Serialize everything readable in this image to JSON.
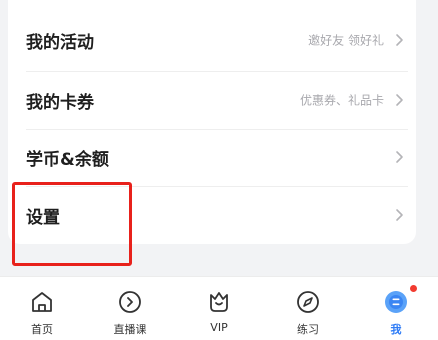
{
  "menu": {
    "items": [
      {
        "label": "我的活动",
        "sub": "邀好友 领好礼"
      },
      {
        "label": "我的卡券",
        "sub": "优惠券、礼品卡"
      },
      {
        "label": "学币&余额",
        "sub": ""
      },
      {
        "label": "设置",
        "sub": ""
      }
    ]
  },
  "tabbar": {
    "tabs": [
      {
        "label": "首页",
        "icon": "home-icon"
      },
      {
        "label": "直播课",
        "icon": "live-icon"
      },
      {
        "label": "VIP",
        "icon": "vip-crown-icon"
      },
      {
        "label": "练习",
        "icon": "practice-icon"
      },
      {
        "label": "我",
        "icon": "me-icon"
      }
    ],
    "active": "我"
  },
  "colors": {
    "highlight": "#e8211b",
    "active_tab": "#2f7cf6",
    "badge": "#f23b30"
  }
}
